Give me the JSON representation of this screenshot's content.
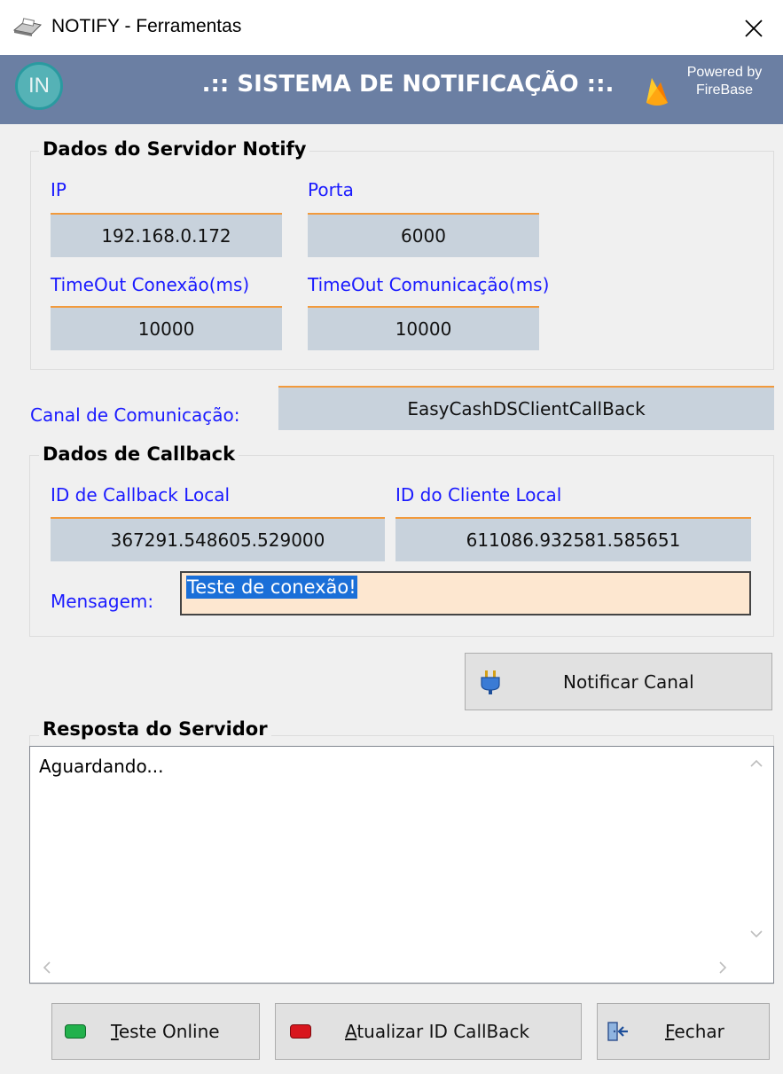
{
  "window": {
    "title": "NOTIFY - Ferramentas",
    "close_glyph": "✕"
  },
  "banner": {
    "logo_text": "IN",
    "title": ".:: SISTEMA DE NOTIFICAÇÃO ::.",
    "powered_line1": "Powered by",
    "powered_line2": "FireBase",
    "fire_icon": "firebase-flame-icon"
  },
  "server_group": {
    "title": "Dados do Servidor Notify",
    "ip_label": "IP",
    "ip_value": "192.168.0.172",
    "port_label": "Porta",
    "port_value": "6000",
    "timeout_conn_label": "TimeOut Conexão(ms)",
    "timeout_conn_value": "10000",
    "timeout_comm_label": "TimeOut Comunicação(ms)",
    "timeout_comm_value": "10000"
  },
  "channel": {
    "label": "Canal de Comunicação:",
    "value": "EasyCashDSClientCallBack"
  },
  "callback_group": {
    "title": "Dados de Callback",
    "callback_id_label": "ID de Callback Local",
    "callback_id_value": "367291.548605.529000",
    "client_id_label": "ID do Cliente Local",
    "client_id_value": "611086.932581.585651",
    "message_label": "Mensagem:",
    "message_value": "Teste de conexão!"
  },
  "notify_button": {
    "label": "Notificar Canal",
    "icon": "plug-icon"
  },
  "response_group": {
    "title": "Resposta do Servidor",
    "text": "Aguardando...",
    "scroll_up": "^",
    "scroll_down": "v",
    "scroll_left": "<",
    "scroll_right": ">"
  },
  "footer": {
    "test_online": {
      "mnemonic": "T",
      "rest": "este Online",
      "status_color": "#22b14c"
    },
    "update_callback": {
      "mnemonic": "A",
      "rest": "tualizar ID CallBack",
      "status_color": "#d8161e"
    },
    "close": {
      "mnemonic": "F",
      "rest": "echar",
      "icon": "exit-door-icon"
    }
  }
}
